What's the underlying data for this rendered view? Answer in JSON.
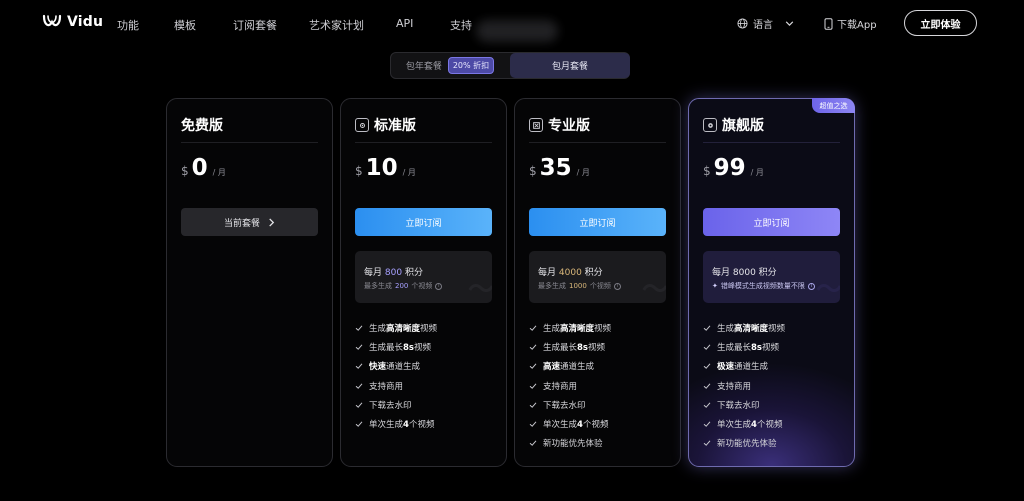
{
  "nav": {
    "brand": "Vidu",
    "links": [
      "功能",
      "模板",
      "订阅套餐",
      "艺术家计划",
      "API",
      "支持"
    ],
    "language": "语言",
    "download_app": "下载App",
    "try_now": "立即体验"
  },
  "billing_toggle": {
    "yearly": "包年套餐",
    "discount": "20% 折扣",
    "monthly": "包月套餐",
    "selected": "包月套餐"
  },
  "plans": [
    {
      "name": "免费版",
      "currency": "$",
      "price": "0",
      "period": "/ 月",
      "cta": "当前套餐",
      "features": []
    },
    {
      "name": "标准版",
      "currency": "$",
      "price": "10",
      "period": "/ 月",
      "cta": "立即订阅",
      "credits_prefix": "每月",
      "credits": "800",
      "credits_suffix": "积分",
      "sub_prefix": "最多生成",
      "sub_value": "200",
      "sub_suffix": "个视频",
      "features": [
        {
          "bold": "",
          "pre": "生成",
          "b": "高清晰度",
          "post": "视频"
        },
        {
          "pre": "生成最长",
          "b": "8s",
          "post": "视频"
        },
        {
          "pre": "",
          "b": "快速",
          "post": "通道生成"
        },
        {
          "pre": "支持商用",
          "b": "",
          "post": ""
        },
        {
          "pre": "下载去水印",
          "b": "",
          "post": ""
        },
        {
          "pre": "单次生成",
          "b": "4",
          "post": "个视频"
        }
      ]
    },
    {
      "name": "专业版",
      "currency": "$",
      "price": "35",
      "period": "/ 月",
      "cta": "立即订阅",
      "credits_prefix": "每月",
      "credits": "4000",
      "credits_suffix": "积分",
      "sub_prefix": "最多生成",
      "sub_value": "1000",
      "sub_suffix": "个视频",
      "features": [
        {
          "pre": "生成",
          "b": "高清晰度",
          "post": "视频"
        },
        {
          "pre": "生成最长",
          "b": "8s",
          "post": "视频"
        },
        {
          "pre": "",
          "b": "高速",
          "post": "通道生成"
        },
        {
          "pre": "支持商用",
          "b": "",
          "post": ""
        },
        {
          "pre": "下载去水印",
          "b": "",
          "post": ""
        },
        {
          "pre": "单次生成",
          "b": "4",
          "post": "个视频"
        },
        {
          "pre": "新功能优先体验",
          "b": "",
          "post": ""
        }
      ]
    },
    {
      "name": "旗舰版",
      "badge": "超值之选",
      "currency": "$",
      "price": "99",
      "period": "/ 月",
      "cta": "立即订阅",
      "credits_prefix": "每月",
      "credits": "8000",
      "credits_suffix": "积分",
      "sub_text": "错峰模式生成视频数量不限",
      "features": [
        {
          "pre": "生成",
          "b": "高清晰度",
          "post": "视频"
        },
        {
          "pre": "生成最长",
          "b": "8s",
          "post": "视频"
        },
        {
          "pre": "",
          "b": "极速",
          "post": "通道生成"
        },
        {
          "pre": "支持商用",
          "b": "",
          "post": ""
        },
        {
          "pre": "下载去水印",
          "b": "",
          "post": ""
        },
        {
          "pre": "单次生成",
          "b": "4",
          "post": "个视频"
        },
        {
          "pre": "新功能优先体验",
          "b": "",
          "post": ""
        }
      ]
    }
  ],
  "colors": {
    "background": "#000000",
    "accent_blue": "#3a9cf4",
    "accent_purple": "#7a72ee",
    "badge": "#7b72ee"
  }
}
